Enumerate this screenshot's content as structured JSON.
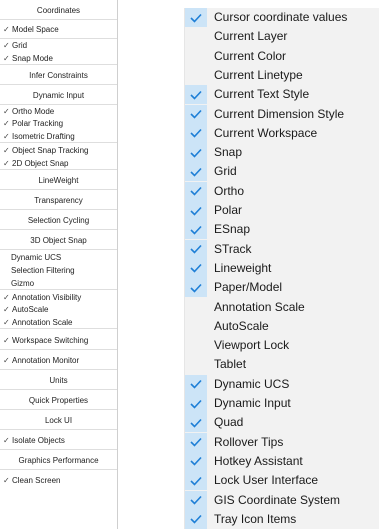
{
  "left_panel": {
    "items": [
      {
        "label": "Coordinates",
        "checked": false,
        "align": "center"
      },
      {
        "label": "Model Space",
        "checked": true,
        "align": "left"
      },
      {
        "label": "Grid",
        "checked": true,
        "align": "left"
      },
      {
        "label": "Snap Mode",
        "checked": true,
        "align": "left"
      },
      {
        "label": "Infer Constraints",
        "checked": false,
        "align": "center"
      },
      {
        "label": "Dynamic Input",
        "checked": false,
        "align": "center"
      },
      {
        "label": "Ortho Mode",
        "checked": true,
        "align": "left"
      },
      {
        "label": "Polar Tracking",
        "checked": true,
        "align": "left"
      },
      {
        "label": "Isometric Drafting",
        "checked": true,
        "align": "left"
      },
      {
        "label": "Object Snap Tracking",
        "checked": true,
        "align": "left"
      },
      {
        "label": "2D Object Snap",
        "checked": true,
        "align": "left"
      },
      {
        "label": "LineWeight",
        "checked": false,
        "align": "center"
      },
      {
        "label": "Transparency",
        "checked": false,
        "align": "center"
      },
      {
        "label": "Selection Cycling",
        "checked": false,
        "align": "center"
      },
      {
        "label": "3D Object Snap",
        "checked": false,
        "align": "center"
      },
      {
        "label": "Dynamic UCS",
        "checked": false,
        "align": "indent"
      },
      {
        "label": "Selection Filtering",
        "checked": false,
        "align": "indent"
      },
      {
        "label": "Gizmo",
        "checked": false,
        "align": "indent"
      },
      {
        "label": "Annotation Visibility",
        "checked": true,
        "align": "left"
      },
      {
        "label": "AutoScale",
        "checked": true,
        "align": "left"
      },
      {
        "label": "Annotation Scale",
        "checked": true,
        "align": "left"
      },
      {
        "label": "Workspace Switching",
        "checked": true,
        "align": "left"
      },
      {
        "label": "Annotation Monitor",
        "checked": true,
        "align": "left"
      },
      {
        "label": "Units",
        "checked": false,
        "align": "center"
      },
      {
        "label": "Quick Properties",
        "checked": false,
        "align": "center"
      },
      {
        "label": "Lock UI",
        "checked": false,
        "align": "center"
      },
      {
        "label": "Isolate Objects",
        "checked": true,
        "align": "left"
      },
      {
        "label": "Graphics Performance",
        "checked": false,
        "align": "center"
      },
      {
        "label": "Clean Screen",
        "checked": true,
        "align": "left"
      }
    ]
  },
  "menu": {
    "items": [
      {
        "label": "Cursor coordinate values",
        "checked": true
      },
      {
        "label": "Current Layer",
        "checked": false
      },
      {
        "label": "Current Color",
        "checked": false
      },
      {
        "label": "Current Linetype",
        "checked": false
      },
      {
        "label": "Current Text Style",
        "checked": true
      },
      {
        "label": "Current Dimension Style",
        "checked": true
      },
      {
        "label": "Current Workspace",
        "checked": true
      },
      {
        "label": "Snap",
        "checked": true
      },
      {
        "label": "Grid",
        "checked": true
      },
      {
        "label": "Ortho",
        "checked": true
      },
      {
        "label": "Polar",
        "checked": true
      },
      {
        "label": "ESnap",
        "checked": true
      },
      {
        "label": "STrack",
        "checked": true
      },
      {
        "label": "Lineweight",
        "checked": true
      },
      {
        "label": "Paper/Model",
        "checked": true
      },
      {
        "label": "Annotation Scale",
        "checked": false
      },
      {
        "label": "AutoScale",
        "checked": false
      },
      {
        "label": "Viewport Lock",
        "checked": false
      },
      {
        "label": "Tablet",
        "checked": false
      },
      {
        "label": "Dynamic UCS",
        "checked": true
      },
      {
        "label": "Dynamic Input",
        "checked": true
      },
      {
        "label": "Quad",
        "checked": true
      },
      {
        "label": "Rollover Tips",
        "checked": true
      },
      {
        "label": "Hotkey Assistant",
        "checked": true
      },
      {
        "label": "Lock User Interface",
        "checked": true
      },
      {
        "label": "GIS Coordinate System",
        "checked": true
      },
      {
        "label": "Tray Icon Items",
        "checked": true
      }
    ]
  },
  "colors": {
    "menu_bg": "#f2f2f2",
    "check_bg": "#cce4f7",
    "check_mark": "#1e7fd6"
  }
}
